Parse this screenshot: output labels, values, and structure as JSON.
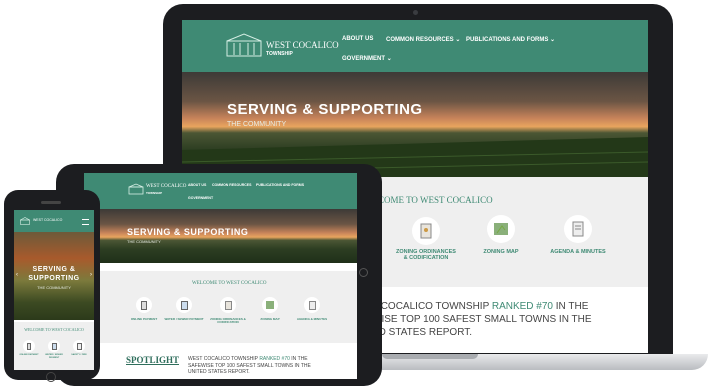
{
  "site": {
    "name_line1": "WEST COCALICO",
    "name_line2": "TOWNSHIP",
    "nav": {
      "about": "ABOUT US",
      "resources": "COMMON RESOURCES",
      "publications": "PUBLICATIONS AND FORMS",
      "government": "GOVERNMENT"
    },
    "hero": {
      "title": "SERVING & SUPPORTING",
      "subtitle": "THE COMMUNITY"
    },
    "phone_hero": {
      "line1": "SERVING &",
      "line2": "SUPPORTING",
      "line3": "THE COMMUNITY"
    },
    "welcome_title": "WELCOME TO WEST COCALICO",
    "laptop_welcome_title": "COME TO WEST COCALICO",
    "quick_links": {
      "zoning_ordinances": "ZONING ORDINANCES & CODIFICATION",
      "zoning_map": "ZONING MAP",
      "agenda": "AGENDA & MINUTES",
      "online_payment": "ONLINE PAYMENT",
      "water_sewer": "WATER / SEWER PAYMENT",
      "safety": "SAFETY / FIRE"
    },
    "laptop_spotlight": {
      "line1_a": "T COCALICO TOWNSHIP ",
      "line1_b": "RANKED #70",
      "line1_c": " IN THE",
      "line2": "WISE TOP 100 SAFEST SMALL TOWNS IN THE",
      "line3": "ED STATES REPORT."
    },
    "tablet_spotlight": {
      "heading": "SPOTLIGHT",
      "text_a": "WEST COCALICO TOWNSHIP ",
      "text_b": "RANKED #70",
      "text_c": " IN THE SAFEWISE TOP 100 SAFEST SMALL TOWNS IN THE UNITED STATES REPORT."
    }
  },
  "icons": [
    "building-logo-icon",
    "chevron-down-icon",
    "document-icon",
    "map-icon",
    "agenda-icon",
    "phone-payment-icon",
    "water-icon",
    "arrow-left-icon",
    "arrow-right-icon"
  ],
  "colors": {
    "brand_green": "#3f8a74",
    "device_black": "#1c1d20",
    "background_gray": "#efefef"
  }
}
